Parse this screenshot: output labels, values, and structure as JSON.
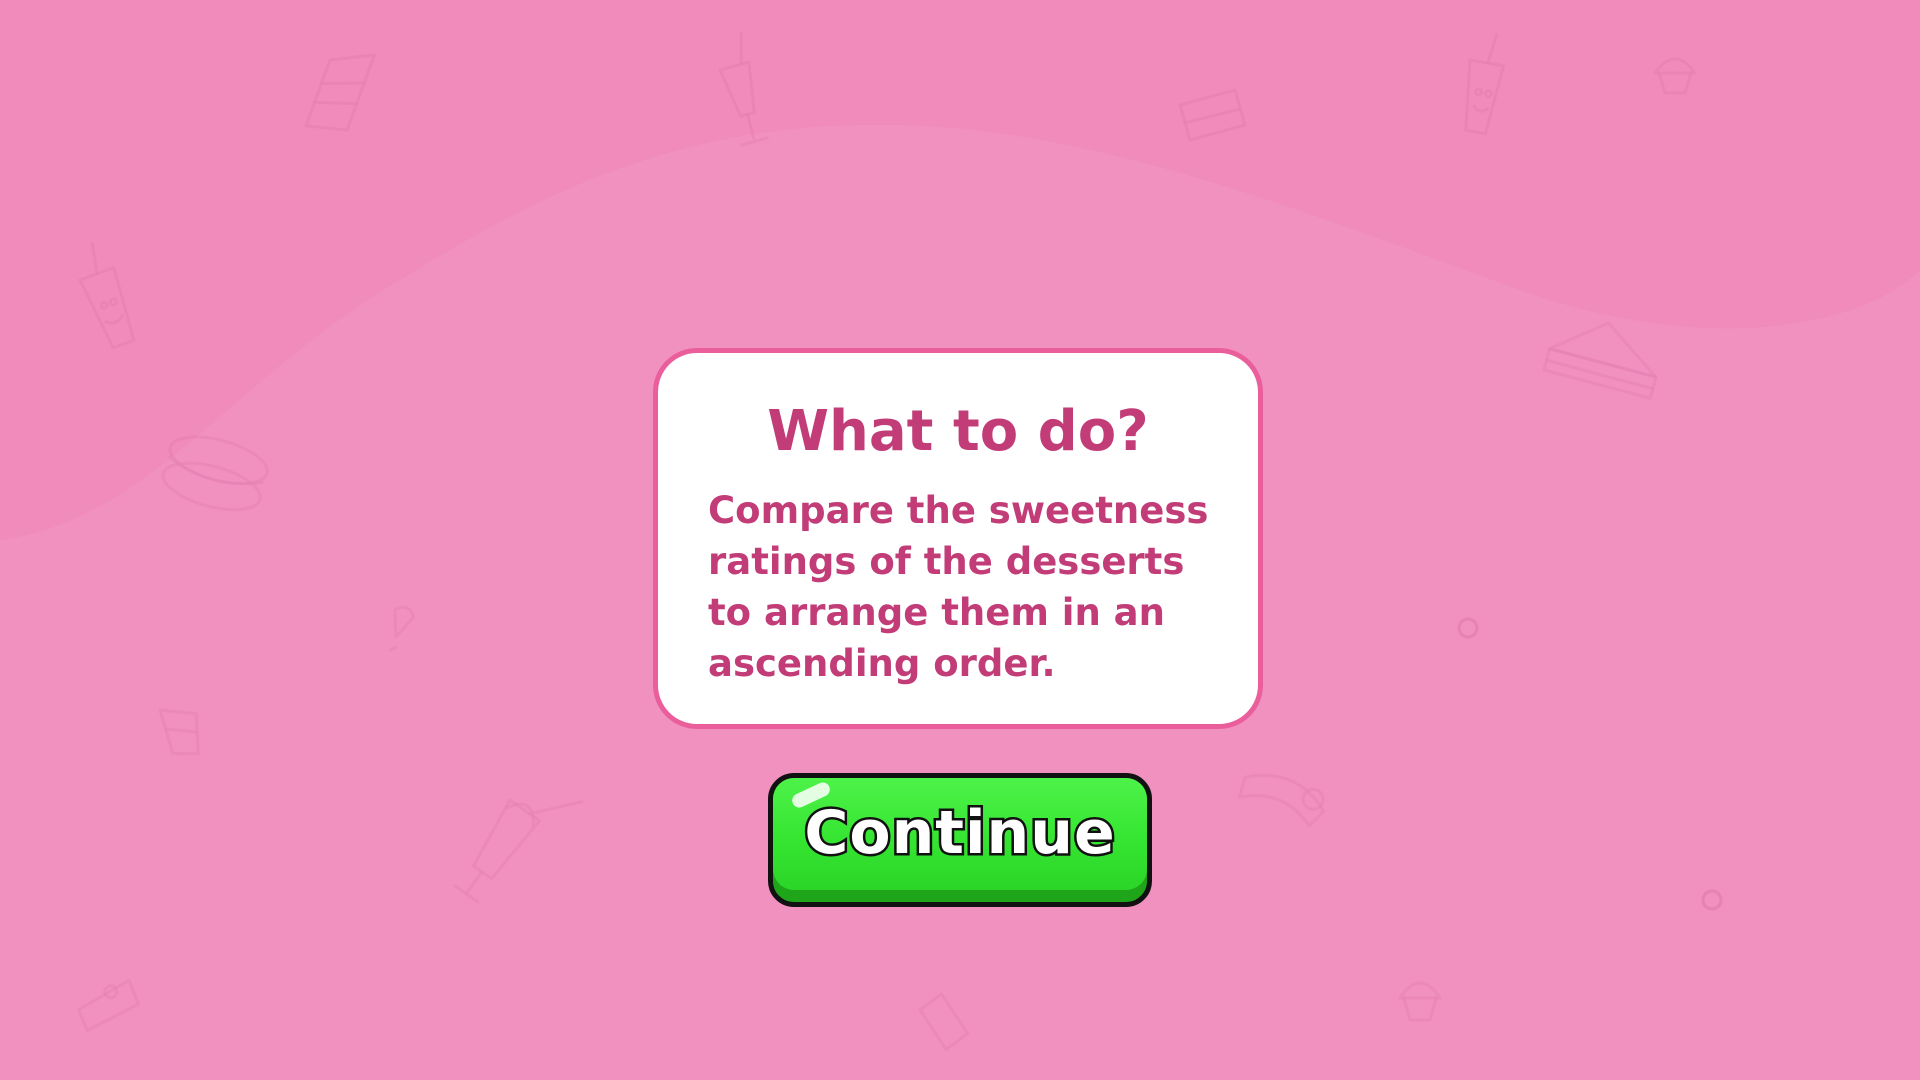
{
  "background": {
    "base_color": "#f08bbb",
    "wave_color": "#f091c0",
    "doodle_icons": [
      "cake-slice-icon",
      "milkshake-icon",
      "sandwich-icon",
      "macaron-icon",
      "cupcake-icon",
      "pie-icon",
      "ice-cream-cone-icon"
    ]
  },
  "instructions": {
    "title": "What to do?",
    "body": "Compare the sweetness ratings of the desserts to arrange them in an ascending order."
  },
  "continue_button": {
    "label": "Continue",
    "color": "#35e531"
  }
}
